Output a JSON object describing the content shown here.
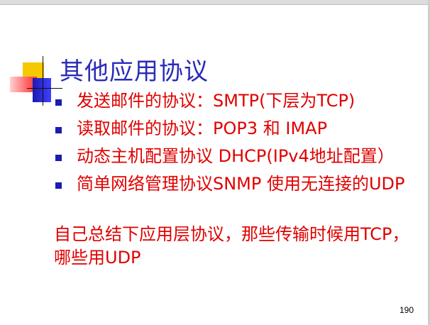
{
  "slide": {
    "title": "其他应用协议",
    "bullets": [
      {
        "text": "发送邮件的协议：SMTP(下层为TCP)"
      },
      {
        "text": "读取邮件的协议：POP3 和 IMAP"
      },
      {
        "text": "动态主机配置协议 DHCP(IPv4地址配置）"
      },
      {
        "text": "简单网络管理协议SNMP 使用无连接的UDP"
      }
    ],
    "summary": "自己总结下应用层协议，那些传输时候用TCP，哪些用UDP",
    "page_number": "190"
  },
  "colors": {
    "title": "#2b2bb8",
    "body_text": "#e00000",
    "bullet": "#1c1cae",
    "logo_yellow": "#f6c800",
    "logo_red": "#ff3030",
    "logo_blue": "#2a2ad0"
  },
  "icons": {
    "logo": "slide-logo-icon",
    "bullet": "square-bullet-icon"
  }
}
